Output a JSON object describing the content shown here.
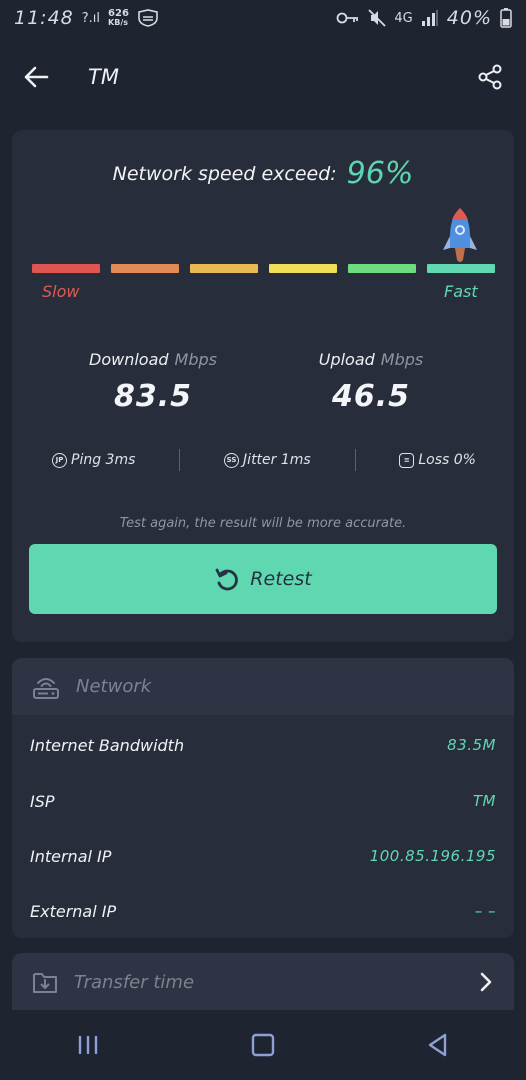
{
  "status_bar": {
    "time": "11:48",
    "speed_value": "626",
    "speed_unit": "KB/s",
    "network_type": "4G",
    "battery": "40%"
  },
  "app_bar": {
    "title": "TM"
  },
  "speed_card": {
    "exceed_label": "Network speed exceed:",
    "exceed_value": "96%",
    "slow_label": "Slow",
    "fast_label": "Fast",
    "bar_colors": [
      "#df5650",
      "#e38a55",
      "#e9b954",
      "#f0e057",
      "#6ddb7e",
      "#62d8b2"
    ],
    "download_label": "Download",
    "download_unit": "Mbps",
    "download_value": "83.5",
    "upload_label": "Upload",
    "upload_unit": "Mbps",
    "upload_value": "46.5",
    "ping_label": "Ping 3ms",
    "jitter_label": "Jitter 1ms",
    "loss_label": "Loss 0%",
    "hint": "Test again, the result will be more accurate.",
    "retest_label": "Retest"
  },
  "network": {
    "title": "Network",
    "rows": [
      {
        "label": "Internet Bandwidth",
        "value": "83.5M"
      },
      {
        "label": "ISP",
        "value": "TM"
      },
      {
        "label": "Internal IP",
        "value": "100.85.196.195"
      },
      {
        "label": "External IP",
        "value": "– –"
      }
    ]
  },
  "transfer": {
    "title": "Transfer time"
  },
  "colors": {
    "accent": "#5fd8b2",
    "background": "#1e2430",
    "card": "#272d3b"
  }
}
